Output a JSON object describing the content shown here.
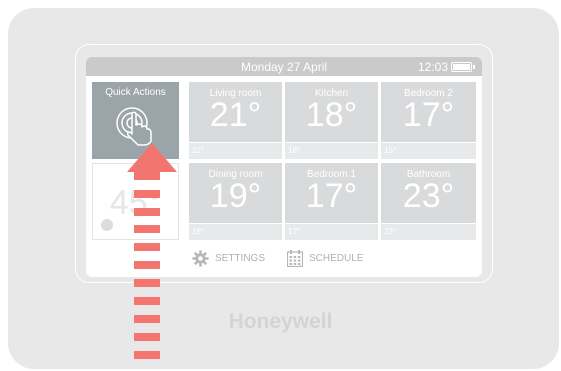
{
  "status": {
    "date": "Monday 27 April",
    "time": "12:03"
  },
  "quick_actions": {
    "label": "Quick Actions"
  },
  "hot_water": {
    "temp": "45°"
  },
  "zones": [
    {
      "name": "Living room",
      "temp": "21°",
      "setpoint": "21°"
    },
    {
      "name": "Kitchen",
      "temp": "18°",
      "setpoint": "18°"
    },
    {
      "name": "Bedroom 2",
      "temp": "17°",
      "setpoint": "15°"
    },
    {
      "name": "Dining room",
      "temp": "19°",
      "setpoint": "18°"
    },
    {
      "name": "Bedroom 1",
      "temp": "17°",
      "setpoint": "17°"
    },
    {
      "name": "Bathroom",
      "temp": "23°",
      "setpoint": "23°"
    }
  ],
  "bottom": {
    "settings": "SETTINGS",
    "schedule": "SCHEDULE"
  },
  "brand": "Honeywell",
  "colors": {
    "arrow": "#f2766f",
    "quick_actions_bg": "#9aa4a9",
    "tile_bg": "#d9dadb"
  },
  "icons": {
    "quick_actions": "hand-tap-icon",
    "settings": "gear-icon",
    "schedule": "calendar-icon",
    "battery": "battery-icon"
  }
}
